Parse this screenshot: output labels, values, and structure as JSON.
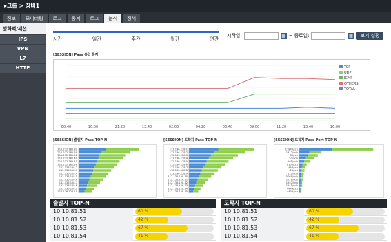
{
  "header": {
    "breadcrumb": "▸그룹 > 장비1"
  },
  "tabs": [
    {
      "label": "정보",
      "active": false
    },
    {
      "label": "모니터링",
      "active": false
    },
    {
      "label": "로그",
      "active": false
    },
    {
      "label": "통계",
      "active": false
    },
    {
      "label": "로그",
      "active": false
    },
    {
      "label": "분석",
      "active": true
    },
    {
      "label": "정책",
      "active": false
    }
  ],
  "sidebar": {
    "title": "방화벽/세션",
    "items": [
      "IPS",
      "VPN",
      "L7",
      "HTTP"
    ]
  },
  "period": {
    "options": [
      "시간",
      "일간",
      "주간",
      "월간",
      "연간"
    ]
  },
  "dates": {
    "start_label": "시작일:",
    "end_label": "~ 종료일:",
    "start_value": "",
    "end_value": "",
    "search_button": "보기 설정"
  },
  "charts": {
    "top_title": "[SESSION] Pass 유입 통계",
    "bar1_title": "[SESSION] 출발지 Pass TOP-N",
    "bar2_title": "[SESSION] 도착지 Pass TOP-N",
    "bar3_title": "[SESSION] 도착지 Pass Port TOP-N"
  },
  "chart_data": [
    {
      "type": "line",
      "title": "[SESSION] Pass 유입 통계",
      "x": [
        "00:40",
        "16:00",
        "21:20",
        "13:40",
        "02:00",
        "04:20",
        "06:40",
        "09:00",
        "11:20",
        "13:40",
        "16:00"
      ],
      "ylim": [
        0,
        5
      ],
      "series": [
        {
          "name": "TCP",
          "color": "#4a8cd6",
          "values": [
            1.1,
            1.1,
            1.1,
            1.1,
            1.1,
            1.1,
            1.1,
            1.1,
            1.1,
            1.2,
            1.1
          ]
        },
        {
          "name": "UDP",
          "color": "#8fcf7a",
          "values": [
            0.2,
            0.2,
            0.2,
            0.2,
            0.2,
            0.2,
            0.2,
            0.2,
            0.2,
            0.2,
            0.2
          ]
        },
        {
          "name": "ICMP",
          "color": "#6cb36c",
          "values": [
            1.6,
            1.6,
            1.6,
            1.6,
            1.6,
            1.6,
            1.6,
            2.4,
            2.4,
            2.4,
            2.4
          ]
        },
        {
          "name": "OTHERS",
          "color": "#d9707a",
          "values": [
            2.9,
            2.9,
            2.9,
            2.9,
            2.9,
            2.9,
            2.9,
            3.9,
            3.8,
            3.8,
            3.7
          ]
        },
        {
          "name": "TOTAL",
          "color": "#7a7ad0",
          "values": [
            0.6,
            0.6,
            0.6,
            0.6,
            0.6,
            0.6,
            0.6,
            0.6,
            0.6,
            0.6,
            0.6
          ]
        }
      ]
    },
    {
      "type": "bar",
      "title": "[SESSION] 출발지 Pass TOP-N",
      "categories": [
        "211.232.182.82",
        "211.232.182.69",
        "211.232.182.42",
        "211.232.182.40",
        "211.232.182.41",
        "211.232.182.36",
        "112.136.128.2",
        "112.136.128.3",
        "112.136.128.4",
        "112.136.128.5",
        "112.136.128.6",
        "112.136.128.7",
        "112.136.128.8",
        "112.136.128.9",
        "112.136.128.10"
      ],
      "values": [
        130,
        110,
        100,
        95,
        88,
        82,
        76,
        70,
        64,
        58,
        52,
        46,
        40,
        34,
        28
      ],
      "xlabel": "",
      "ylabel": "",
      "ylim": [
        0,
        160
      ]
    },
    {
      "type": "bar",
      "title": "[SESSION] 도착지 Pass TOP-N",
      "categories": [
        "112.136.128.1",
        "112.136.128.2",
        "112.136.128.3",
        "112.136.128.4",
        "112.136.128.5",
        "112.136.128.6",
        "112.136.128.7",
        "112.136.128.8",
        "112.136.128.9",
        "112.136.128.10",
        "112.136.128.11",
        "112.136.128.12",
        "112.136.128.13",
        "112.136.128.14",
        "112.136.128.15"
      ],
      "values": [
        140,
        120,
        105,
        95,
        85,
        78,
        70,
        62,
        55,
        48,
        41,
        35,
        30,
        25,
        20
      ],
      "xlabel": "",
      "ylabel": "",
      "ylim": [
        0,
        160
      ]
    },
    {
      "type": "bar",
      "title": "[SESSION] 도착지 Pass Port TOP-N",
      "categories": [
        "17840/tcp",
        "1812/udp",
        "80/tcp",
        "53/udp",
        "161/udp",
        "8100/tcp",
        "443/tcp",
        "25/tcp",
        "123/udp",
        "5061/udp",
        "1721/udp",
        "1947/udp",
        "1245/udp",
        "4443/tcp",
        "4435/tcp"
      ],
      "values": [
        1.0,
        0.3,
        0.25,
        0.2,
        0.15,
        0.1,
        0.08,
        0.07,
        0.06,
        0.05,
        0.05,
        0.04,
        0.04,
        0.03,
        0.03
      ],
      "xlabel": "",
      "ylabel": "",
      "ylim": [
        0,
        1.1
      ]
    }
  ],
  "top_src": {
    "title": "출발지 TOP-N",
    "rows": [
      {
        "ip": "10.10.81.51",
        "pct": "60 %",
        "value": 60
      },
      {
        "ip": "10.10.81.52",
        "pct": "42 %",
        "value": 42
      },
      {
        "ip": "10.10.81.53",
        "pct": "67 %",
        "value": 67
      },
      {
        "ip": "10.10.81.54",
        "pct": "41 %",
        "value": 41
      }
    ]
  },
  "top_dst": {
    "title": "도착지 TOP-N",
    "rows": [
      {
        "ip": "10.10.81.51",
        "pct": "60 %",
        "value": 60
      },
      {
        "ip": "10.10.81.52",
        "pct": "42 %",
        "value": 42
      },
      {
        "ip": "10.10.81.53",
        "pct": "67 %",
        "value": 67
      },
      {
        "ip": "10.10.81.54",
        "pct": "41 %",
        "value": 41
      }
    ]
  }
}
